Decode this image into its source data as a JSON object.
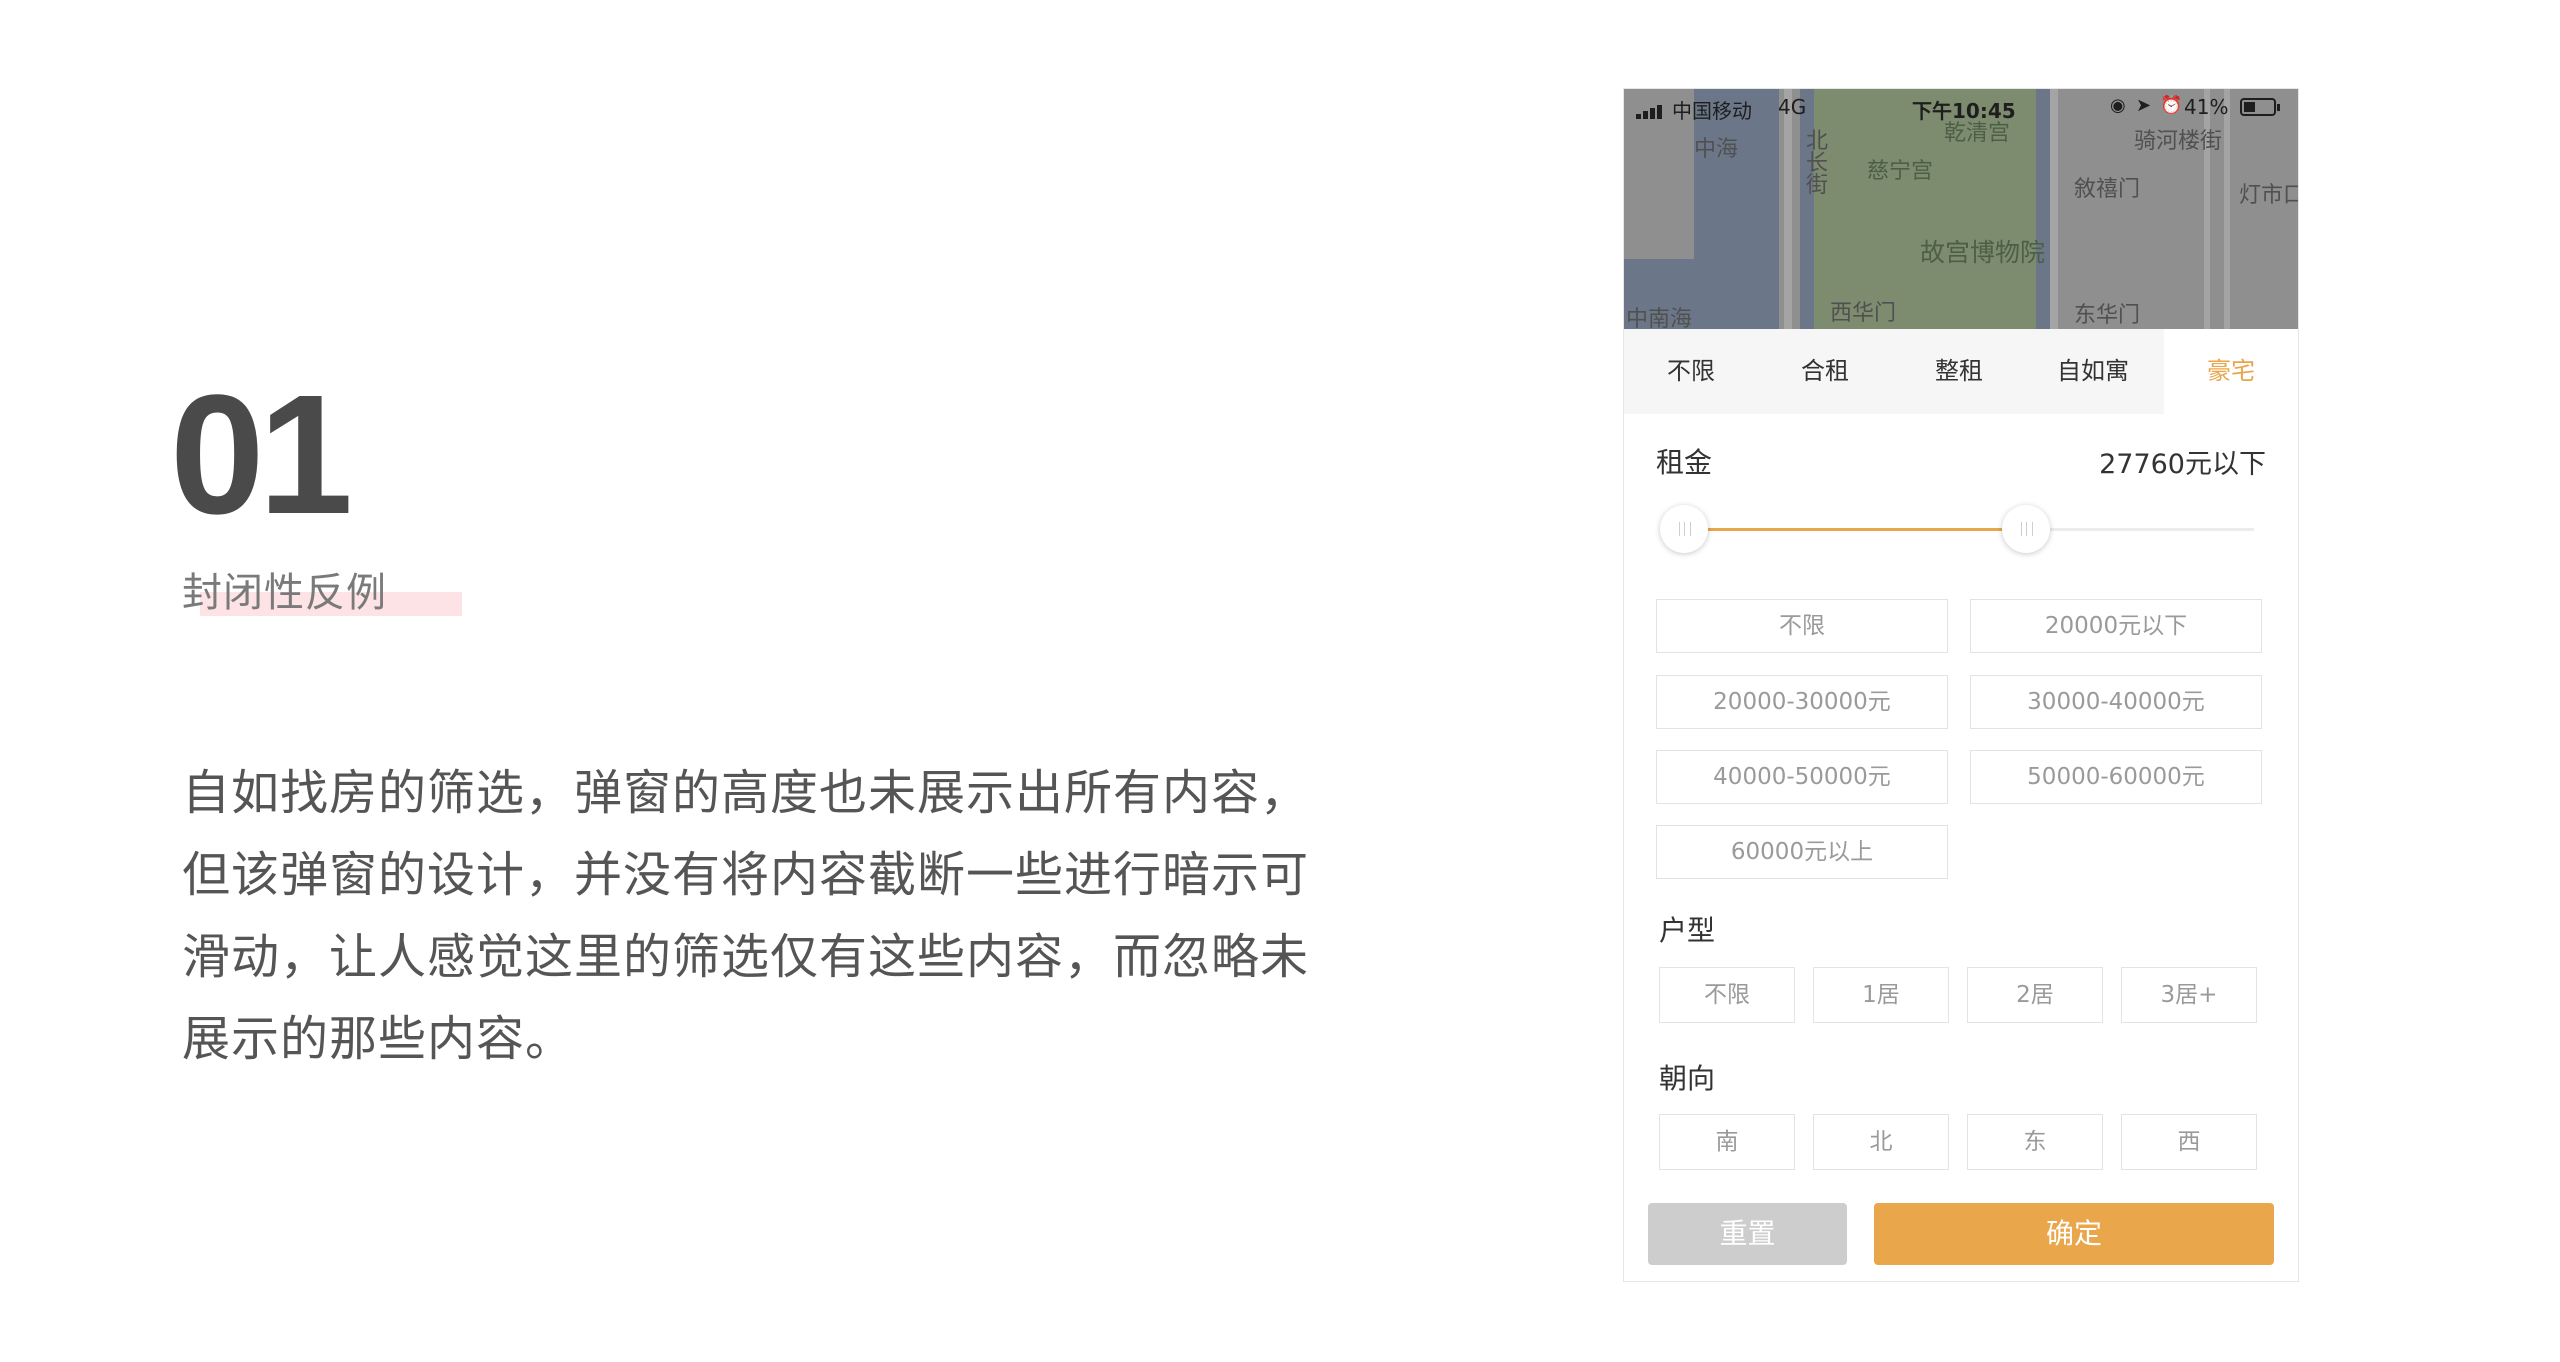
{
  "slide": {
    "number": "01",
    "subtitle": "封闭性反例",
    "description": [
      "自如找房的筛选，弹窗的高度也未展示出所有内容，",
      "但该弹窗的设计，并没有将内容截断一些进行暗示可",
      "滑动，让人感觉这里的筛选仅有这些内容，而忽略未",
      "展示的那些内容。"
    ]
  },
  "phone": {
    "status_bar": {
      "carrier": "中国移动",
      "network": "4G",
      "time": "下午10:45",
      "battery": "41%",
      "battery_level": 0.41
    },
    "map_labels": {
      "zhonghai": "中海",
      "beichangjie": "北长街",
      "qianqinggong": "乾清宫",
      "ciningong": "慈宁宫",
      "qihelou": "骑河楼街",
      "xuximen": "敘禧门",
      "dengshikou": "灯市口",
      "gugong": "故宫博物院",
      "zhongnanhai": "中南海",
      "xihuamen": "西华门",
      "donghuamen": "东华门"
    },
    "tabs": [
      {
        "label": "不限"
      },
      {
        "label": "合租"
      },
      {
        "label": "整租"
      },
      {
        "label": "自如寓"
      },
      {
        "label": "豪宅",
        "active": true
      }
    ],
    "rent": {
      "title": "租金",
      "value": "27760元以下",
      "slider": {
        "min": 0,
        "max": 1,
        "low": 0,
        "high": 0.6
      },
      "options": [
        "不限",
        "20000元以下",
        "20000-30000元",
        "30000-40000元",
        "40000-50000元",
        "50000-60000元",
        "60000元以上"
      ]
    },
    "room_type": {
      "title": "户型",
      "options": [
        "不限",
        "1居",
        "2居",
        "3居+"
      ]
    },
    "orientation": {
      "title": "朝向",
      "options": [
        "南",
        "北",
        "东",
        "西"
      ]
    },
    "buttons": {
      "reset": "重置",
      "confirm": "确定"
    },
    "colors": {
      "accent": "#eaa64b",
      "reset_bg": "#cdcdcd",
      "highlight": "#fde3e5"
    }
  }
}
